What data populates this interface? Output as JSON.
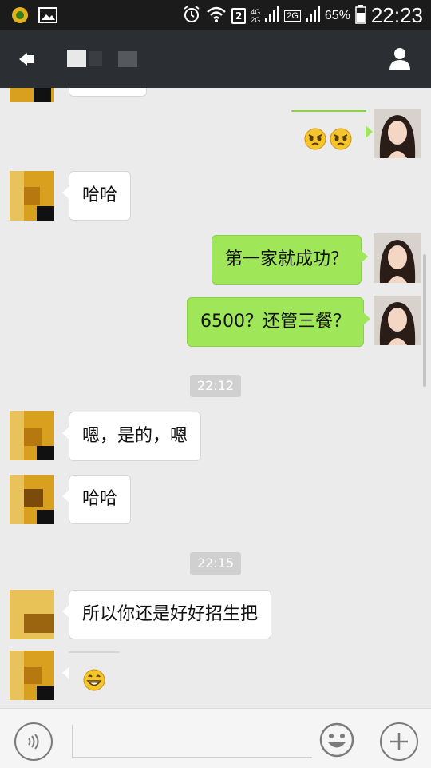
{
  "status_bar": {
    "network_4g": "4G",
    "network_2g": "2G",
    "network_2g_box": "2G",
    "sim_slot": "2",
    "battery_percent": "65%",
    "time": "22:23"
  },
  "chat": {
    "messages": [
      {
        "side": "self",
        "type": "emoji",
        "emoji": [
          "angry-face",
          "angry-face"
        ]
      },
      {
        "side": "other",
        "type": "text",
        "text": "哈哈"
      },
      {
        "side": "self",
        "type": "text",
        "text": "第一家就成功？"
      },
      {
        "side": "self",
        "type": "text",
        "text": "6500？还管三餐？"
      },
      {
        "side": "time",
        "text": "22:12"
      },
      {
        "side": "other",
        "type": "text",
        "text": "嗯，是的，嗯"
      },
      {
        "side": "other",
        "type": "text",
        "text": "哈哈"
      },
      {
        "side": "time",
        "text": "22:15"
      },
      {
        "side": "other",
        "type": "text",
        "text": "所以你还是好好招生把"
      },
      {
        "side": "other",
        "type": "emoji",
        "emoji": [
          "grinning-face"
        ]
      }
    ]
  },
  "colors": {
    "statusbar_bg": "#1b1b1b",
    "titlebar_bg": "#2b2e33",
    "chat_bg": "#ebebeb",
    "bubble_self": "#9fe658",
    "bubble_other": "#ffffff",
    "timestamp_bg": "#d0d0d0"
  }
}
